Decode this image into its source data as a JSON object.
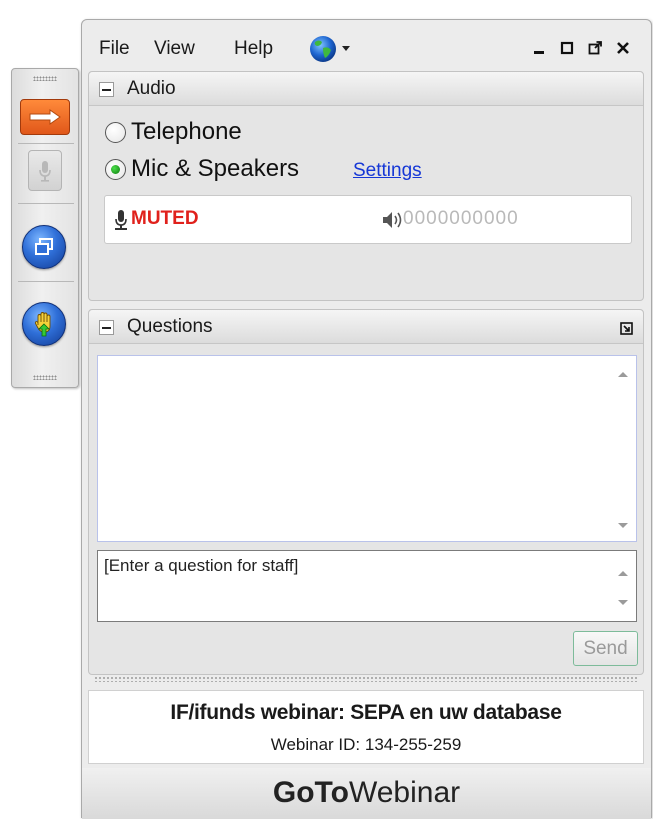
{
  "menu": {
    "file": "File",
    "view": "View",
    "help": "Help",
    "globe_icon": "globe-icon",
    "window_controls": [
      "minimize-icon",
      "maximize-icon",
      "popout-icon",
      "close-icon"
    ]
  },
  "audio": {
    "title": "Audio",
    "options": [
      {
        "label": "Telephone",
        "selected": false
      },
      {
        "label": "Mic & Speakers",
        "selected": true
      }
    ],
    "settings_label": "Settings",
    "status": "MUTED",
    "level_meter": "0000000000"
  },
  "questions": {
    "title": "Questions",
    "input_placeholder": "[Enter a question for staff]",
    "send_label": "Send"
  },
  "webinar": {
    "title": "IF/ifunds webinar: SEPA en uw database",
    "id_line": "Webinar ID: 134-255-259"
  },
  "brand": {
    "strong": "GoTo",
    "light": "Webinar"
  },
  "toolbar": {
    "buttons": [
      "arrow-icon",
      "microphone-icon",
      "window-icon",
      "raise-hand-icon"
    ]
  },
  "colors": {
    "muted": "#e0211c",
    "link": "#1537d6",
    "arrow_button": "#ff7a2a",
    "round_button": "#2f6fd8"
  }
}
